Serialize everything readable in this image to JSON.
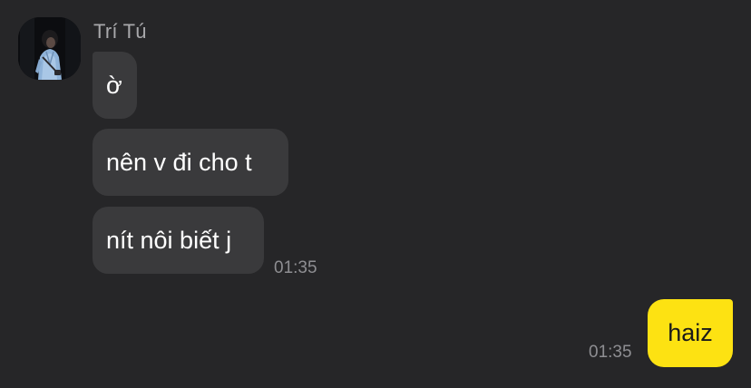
{
  "conversation": {
    "sender": {
      "name": "Trí Tú",
      "avatar_icon": "profile-photo"
    },
    "incoming": [
      {
        "text": "ờ"
      },
      {
        "text": "nên v đi cho t"
      },
      {
        "text": "nít nôi biết j"
      }
    ],
    "incoming_time": "01:35",
    "outgoing": [
      {
        "text": "haiz"
      }
    ],
    "outgoing_time": "01:35"
  },
  "colors": {
    "background": "#262628",
    "incoming_bubble": "#3a3a3c",
    "outgoing_bubble": "#fde212",
    "timestamp": "#8e8e92"
  }
}
